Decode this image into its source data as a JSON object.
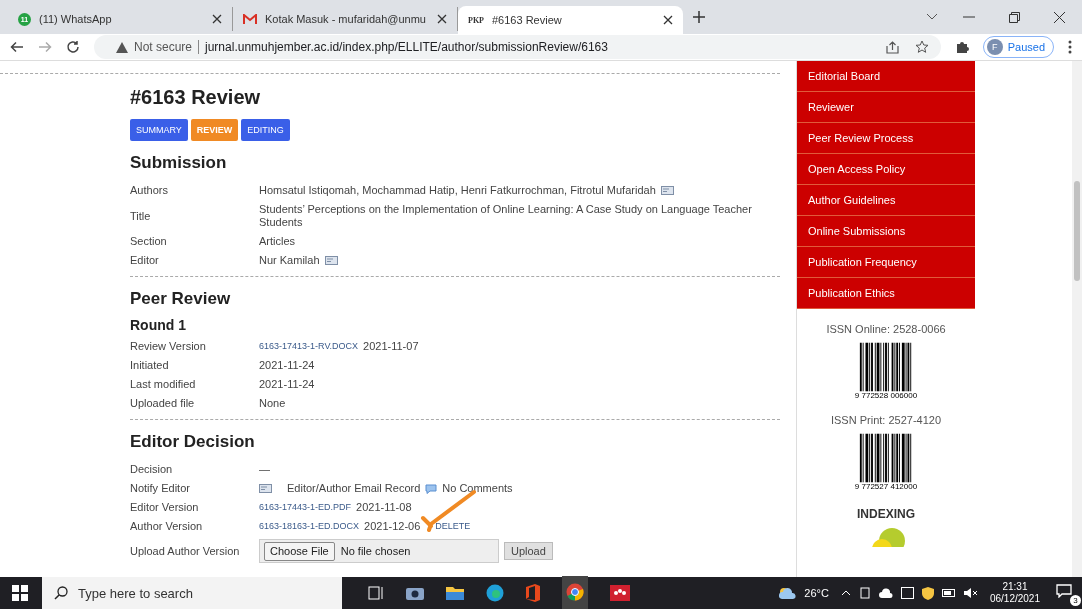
{
  "browser": {
    "tabs": [
      {
        "title": "(11) WhatsApp",
        "kind": "badge",
        "icon_text": "11",
        "selected": false
      },
      {
        "title": "Kotak Masuk - mufaridah@unmu",
        "kind": "mail",
        "selected": false
      },
      {
        "title": "#6163 Review",
        "kind": "text",
        "icon_text": "PKP",
        "selected": true
      }
    ],
    "security": "Not secure",
    "url": "jurnal.unmuhjember.ac.id/index.php/ELLITE/author/submissionReview/6163",
    "profile_initial": "F",
    "profile_status": "Paused"
  },
  "page": {
    "title": "#6163 Review",
    "tabs": [
      {
        "label": "SUMMARY",
        "selected": false
      },
      {
        "label": "REVIEW",
        "selected": true
      },
      {
        "label": "EDITING",
        "selected": false
      }
    ],
    "submission": {
      "heading": "Submission",
      "rows": [
        {
          "label": "Authors",
          "value": "Homsatul Istiqomah, Mochammad Hatip, Henri Fatkurrochman, Fitrotul Mufaridah",
          "email_icon": true
        },
        {
          "label": "Title",
          "value": "Students’ Perceptions on the Implementation of Online Learning: A Case Study on Language Teacher Students",
          "email_icon": false
        },
        {
          "label": "Section",
          "value": "Articles",
          "email_icon": false
        },
        {
          "label": "Editor",
          "value": "Nur Kamilah",
          "email_icon": true
        }
      ]
    },
    "peer_review": {
      "heading": "Peer Review",
      "round": "Round 1",
      "rows": [
        {
          "label": "Review Version",
          "link": "6163-17413-1-RV.DOCX",
          "value": "2021-11-07"
        },
        {
          "label": "Initiated",
          "value": "2021-11-24"
        },
        {
          "label": "Last modified",
          "value": "2021-11-24"
        },
        {
          "label": "Uploaded file",
          "value": "None"
        }
      ]
    },
    "editor_decision": {
      "heading": "Editor Decision",
      "rows": [
        {
          "kind": "text",
          "label": "Decision",
          "value": "—"
        },
        {
          "kind": "notify",
          "label": "Notify Editor",
          "value": "Editor/Author Email Record",
          "comments": "No Comments"
        },
        {
          "kind": "file",
          "label": "Editor Version",
          "link": "6163-17443-1-ED.PDF",
          "value": "2021-11-08"
        },
        {
          "kind": "file",
          "label": "Author Version",
          "link": "6163-18163-1-ED.DOCX",
          "value": "2021-12-06",
          "action": "DELETE"
        },
        {
          "kind": "upload",
          "label": "Upload Author Version",
          "choose": "Choose File",
          "status": "No file chosen",
          "submit": "Upload"
        }
      ]
    }
  },
  "sidebar": {
    "menu": [
      "Editorial Board",
      "Reviewer",
      "Peer Review Process",
      "Open Access Policy",
      "Author Guidelines",
      "Online Submissions",
      "Publication Frequency",
      "Publication Ethics"
    ],
    "issn": [
      {
        "label": "ISSN Online: 2528-0066",
        "barcode": "9 772528 006000"
      },
      {
        "label": "ISSN Print: 2527-4120",
        "barcode": "9 772527 412000"
      }
    ],
    "indexing": "INDEXING"
  },
  "taskbar": {
    "search_placeholder": "Type here to search",
    "temperature": "26°C",
    "time": "21:31",
    "date": "06/12/2021",
    "notifications": "3"
  }
}
